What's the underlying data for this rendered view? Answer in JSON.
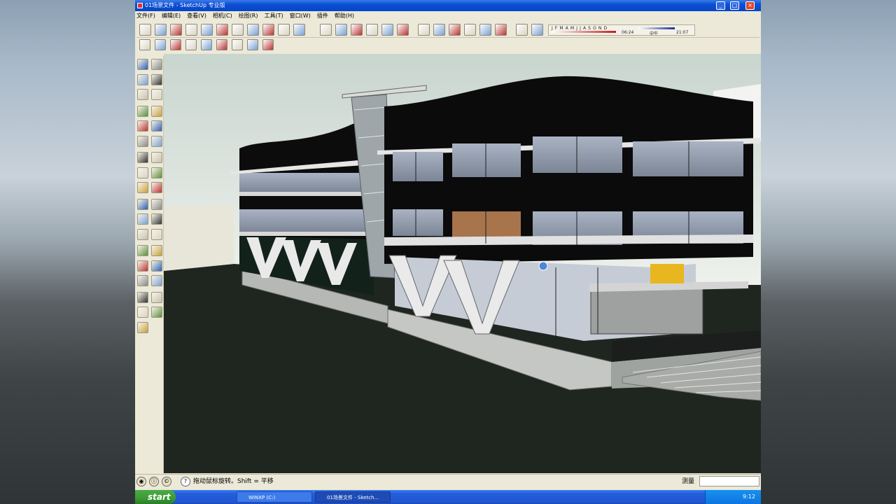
{
  "window": {
    "title": "01场景文件 - SketchUp 专业版",
    "controls": {
      "minimize": "_",
      "maximize": "□",
      "close": "×"
    }
  },
  "menu": [
    {
      "label": "文件(F)"
    },
    {
      "label": "编辑(E)"
    },
    {
      "label": "查看(V)"
    },
    {
      "label": "相机(C)"
    },
    {
      "label": "绘图(R)"
    },
    {
      "label": "工具(T)"
    },
    {
      "label": "窗口(W)"
    },
    {
      "label": "插件"
    },
    {
      "label": "帮助(H)"
    }
  ],
  "shadow_settings": {
    "months": "J F M A M J J A S O N D",
    "time_start": "06:24",
    "noon": "中午",
    "time_end": "21:07"
  },
  "toolbar1_icons": [
    "new-file-icon",
    "open-icon",
    "save-icon",
    "cut-icon",
    "copy-icon",
    "paste-icon",
    "erase-icon",
    "undo-icon",
    "redo-icon",
    "print-icon",
    "model-info-icon",
    "iso-view-icon",
    "top-view-icon",
    "front-view-icon",
    "right-view-icon",
    "back-view-icon",
    "left-view-icon",
    "xray-icon",
    "wireframe-icon",
    "hidden-line-icon",
    "shaded-icon",
    "shaded-texture-icon",
    "monochrome-icon",
    "section-plane-icon",
    "section-cut-icon"
  ],
  "toolbar2_icons": [
    "tag-tool-1-icon",
    "tag-tool-2-icon",
    "tag-tool-3-icon",
    "component-icon",
    "sphere-icon",
    "paint-icon",
    "sun-icon",
    "circle-icon",
    "clip-icon"
  ],
  "left_tools": [
    "select-icon",
    "make-component-icon",
    "paint-bucket-icon",
    "eraser-icon",
    "rectangle-icon",
    "line-icon",
    "circle-icon",
    "arc-icon",
    "polygon-icon",
    "freehand-icon",
    "move-icon",
    "push-pull-icon",
    "rotate-icon",
    "follow-me-icon",
    "scale-icon",
    "offset-icon",
    "tape-measure-icon",
    "dimension-icon",
    "protractor-icon",
    "text-icon",
    "axes-icon",
    "3d-text-icon",
    "orbit-icon",
    "pan-icon",
    "zoom-icon",
    "zoom-window-icon",
    "zoom-extents-icon",
    "previous-view-icon",
    "position-camera-icon",
    "look-around-icon",
    "walk-icon",
    "footprints-icon",
    "section-icon",
    "section-display-icon",
    "sandbox-icon"
  ],
  "status": {
    "hint": "拖动鼠标旋转。Shift = 平移",
    "measure_label": "测量",
    "measure_value": ""
  },
  "taskbar": {
    "start": "start",
    "buttons": [
      "WINXP (C:)",
      "01场景文件 - Sketch..."
    ],
    "clock": "9:12"
  },
  "colors": {
    "titlebar": "#0a4fd4",
    "sky": "#dfe6df",
    "ground": "#1f2620",
    "building_dark": "#0d0d0d",
    "concrete": "#bfc2c1"
  }
}
